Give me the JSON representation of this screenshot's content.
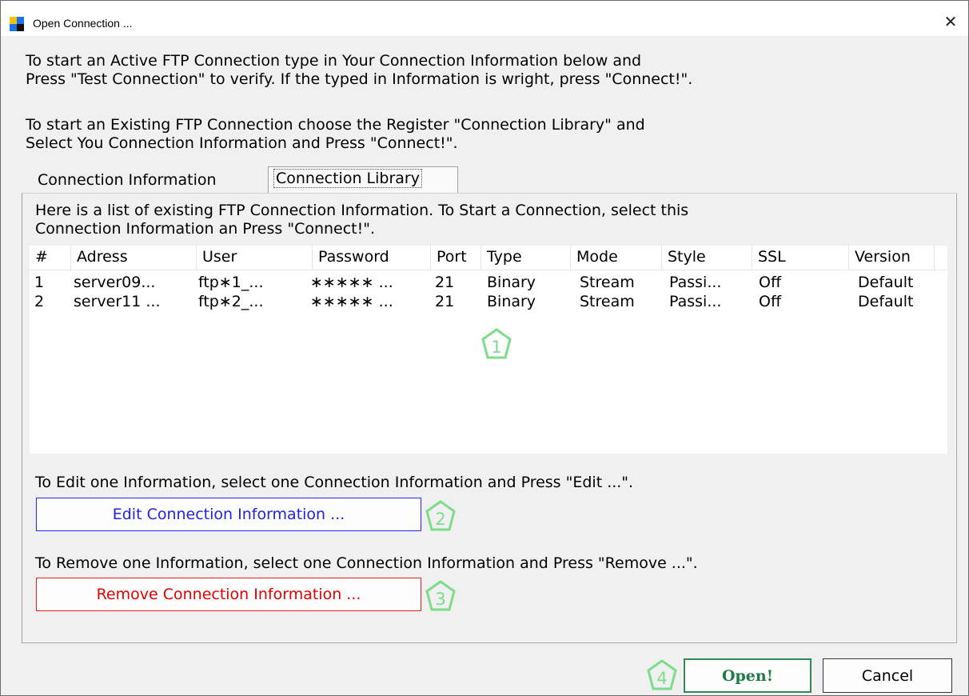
{
  "window": {
    "title": "Open Connection ...",
    "close_glyph": "✕",
    "icon": "app-icon"
  },
  "intro": {
    "line1": "To start an Active FTP Connection type in Your Connection Information below and",
    "line2": "Press \"Test Connection\" to verify. If the typed in Information is wright, press \"Connect!\".",
    "line3": "To start an Existing FTP Connection choose the Register \"Connection Library\" and",
    "line4": "Select You Connection Information and Press \"Connect!\"."
  },
  "tabs": [
    {
      "label": "Connection Information",
      "selected": false
    },
    {
      "label": "Connection Library",
      "selected": true
    }
  ],
  "library": {
    "description_line1": "Here is a list of existing FTP Connection Information. To Start a Connection, select this",
    "description_line2": "Connection Information an Press \"Connect!\".",
    "columns": [
      "#",
      "Adress",
      "User",
      "Password",
      "Port",
      "Type",
      "Mode",
      "Style",
      "SSL",
      "Version"
    ],
    "rows": [
      [
        "1",
        "server09...",
        "ftp∗1_...",
        "∗∗∗∗∗ ...",
        "21",
        "Binary",
        "Stream",
        "Passi...",
        "Off",
        "Default"
      ],
      [
        "2",
        "server11 ...",
        "ftp∗2_...",
        "∗∗∗∗∗ ...",
        "21",
        "Binary",
        "Stream",
        "Passi...",
        "Off",
        "Default"
      ]
    ],
    "edit_text": "To Edit one Information, select one Connection Information and Press \"Edit ...\".",
    "edit_button": "Edit Connection Information ...",
    "remove_text": "To Remove one Information, select one Connection Information and Press \"Remove ...\".",
    "remove_button": "Remove Connection Information ..."
  },
  "callouts": {
    "one": "1",
    "two": "2",
    "three": "3",
    "four": "4",
    "color": "#7ddc8a"
  },
  "footer": {
    "open_button": "Open!",
    "cancel_button": "Cancel"
  },
  "colors": {
    "edit": "#2222dd",
    "remove": "#e00000",
    "open": "#1f7a45"
  }
}
